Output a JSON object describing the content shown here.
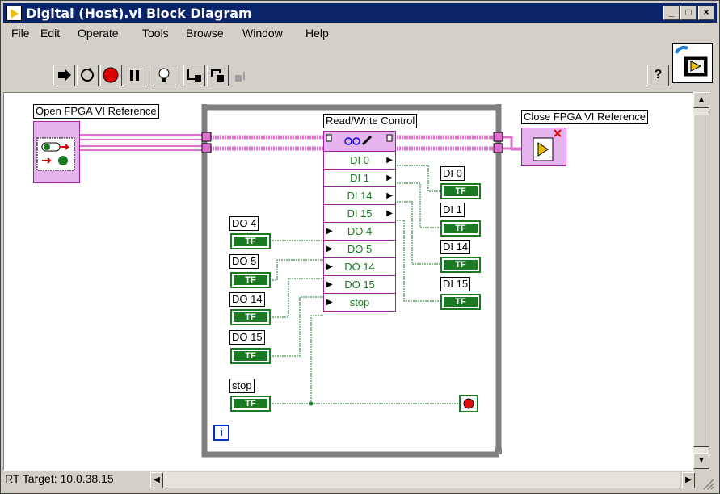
{
  "window": {
    "title": "Digital (Host).vi Block Diagram",
    "controls": [
      "_",
      "□",
      "×"
    ]
  },
  "menu": [
    "File",
    "Edit",
    "Operate",
    "Tools",
    "Browse",
    "Window",
    "Help"
  ],
  "help_button": "?",
  "diagram": {
    "open_ref_label": "Open FPGA VI Reference",
    "close_ref_label": "Close FPGA VI Reference",
    "rw_label": "Read/Write Control",
    "rw_outputs": [
      "DI 0",
      "DI 1",
      "DI 14",
      "DI 15"
    ],
    "rw_inputs": [
      "DO 4",
      "DO 5",
      "DO 14",
      "DO 15",
      "stop"
    ],
    "do_terminals": [
      "DO 4",
      "DO 5",
      "DO 14",
      "DO 15"
    ],
    "di_terminals": [
      "DI 0",
      "DI 1",
      "DI 14",
      "DI 15"
    ],
    "stop_label": "stop",
    "bool_text": "TF",
    "iteration": "i"
  },
  "status": {
    "target": "RT Target: 10.0.38.15"
  },
  "colors": {
    "titlebar": "#0a246a",
    "wire_ref": "#e070d0",
    "bool_green": "#1c7a24",
    "loop_gray": "#808080"
  }
}
